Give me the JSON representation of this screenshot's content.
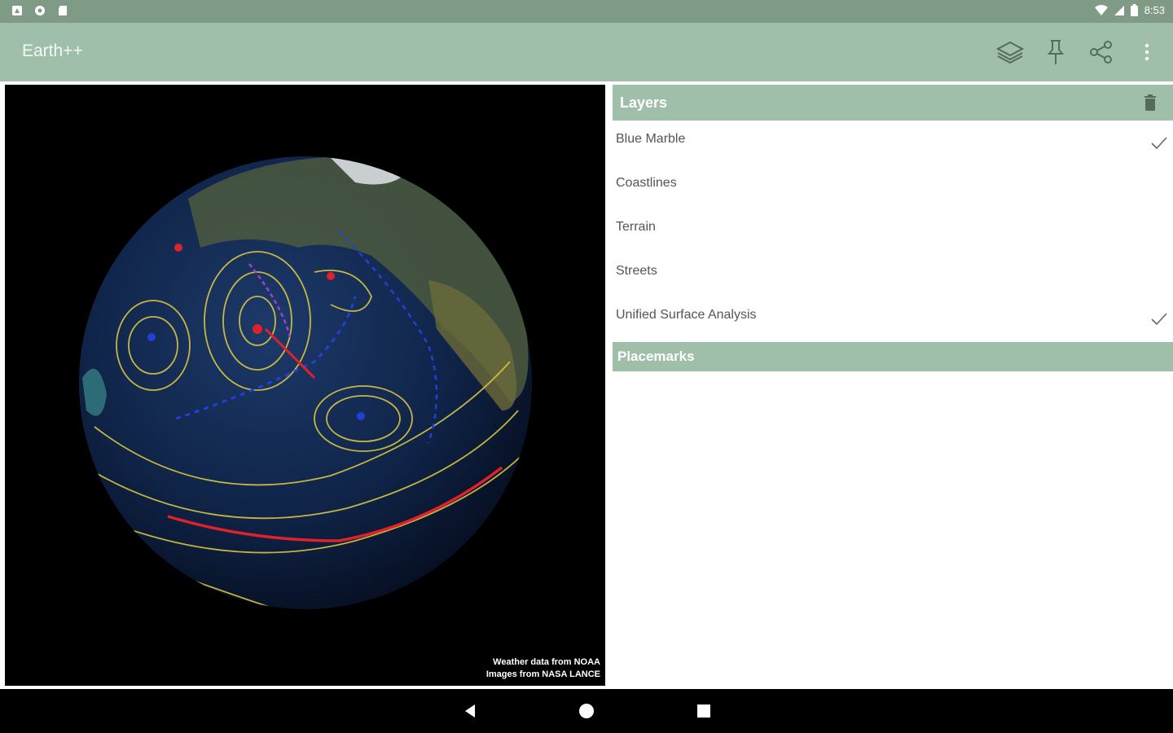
{
  "status_bar": {
    "time": "8:53",
    "left_icons": [
      "notification-icon",
      "settings-circle-icon",
      "sd-card-icon"
    ],
    "right_icons": [
      "wifi-icon",
      "signal-icon",
      "battery-icon"
    ]
  },
  "app_bar": {
    "title": "Earth++",
    "actions": [
      "layers-icon",
      "pin-icon",
      "share-icon",
      "overflow-menu-icon"
    ]
  },
  "globe": {
    "credit_line_1": "Weather data from NOAA",
    "credit_line_2": "Images from NASA LANCE"
  },
  "layers_panel": {
    "header": "Layers",
    "header_icon": "trash-icon",
    "items": [
      {
        "label": "Blue Marble",
        "checked": true
      },
      {
        "label": "Coastlines",
        "checked": false
      },
      {
        "label": "Terrain",
        "checked": false
      },
      {
        "label": "Streets",
        "checked": false
      },
      {
        "label": "Unified Surface Analysis",
        "checked": true
      }
    ]
  },
  "placemarks_panel": {
    "header": "Placemarks"
  },
  "nav_bar": {
    "buttons": [
      "back-icon",
      "home-icon",
      "recents-icon"
    ]
  },
  "colors": {
    "status_bar": "#7f9a85",
    "app_bar": "#9fbfaa",
    "section_header": "#9fbfaa",
    "globe_background": "#000000"
  }
}
